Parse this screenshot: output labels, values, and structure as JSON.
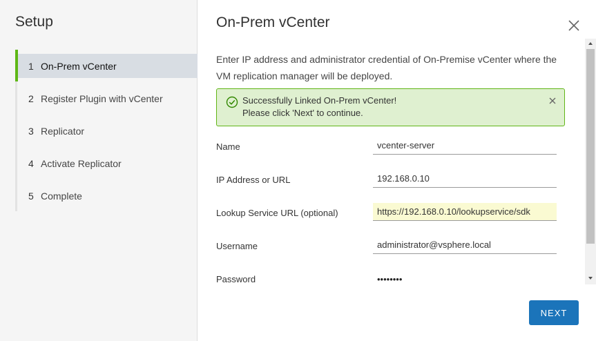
{
  "setup": {
    "title": "Setup",
    "steps": [
      {
        "num": "1",
        "label": "On-Prem vCenter",
        "active": true
      },
      {
        "num": "2",
        "label": "Register Plugin with vCenter",
        "active": false
      },
      {
        "num": "3",
        "label": "Replicator",
        "active": false
      },
      {
        "num": "4",
        "label": "Activate Replicator",
        "active": false
      },
      {
        "num": "5",
        "label": "Complete",
        "active": false
      }
    ]
  },
  "page": {
    "title": "On-Prem vCenter",
    "intro": "Enter IP address and administrator credential of On-Premise vCenter where the VM replication manager will be deployed."
  },
  "alert": {
    "line1": "Successfully Linked On-Prem vCenter!",
    "line2": "Please click 'Next' to continue.",
    "icon": "check-circle-icon",
    "color": "#60b515"
  },
  "form": {
    "name": {
      "label": "Name",
      "value": "vcenter-server"
    },
    "ip": {
      "label": "IP Address or URL",
      "value": "192.168.0.10"
    },
    "lookup": {
      "label": "Lookup Service URL (optional)",
      "value": "https://192.168.0.10/lookupservice/sdk"
    },
    "username": {
      "label": "Username",
      "value": "administrator@vsphere.local"
    },
    "password": {
      "label": "Password",
      "value": "••••••••"
    }
  },
  "actions": {
    "next_label": "NEXT",
    "accent": "#1b74ba"
  }
}
